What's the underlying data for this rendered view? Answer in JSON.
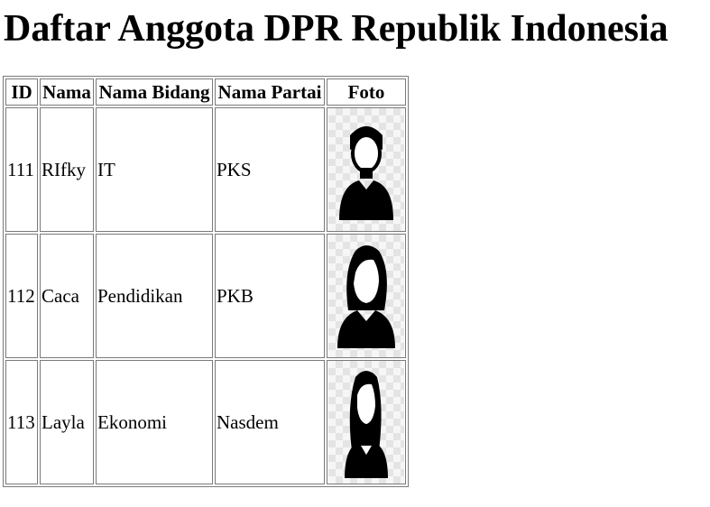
{
  "page": {
    "title": "Daftar Anggota DPR Republik Indonesia"
  },
  "table": {
    "headers": {
      "id": "ID",
      "nama": "Nama",
      "bidang": "Nama Bidang",
      "partai": "Nama Partai",
      "foto": "Foto"
    },
    "rows": [
      {
        "id": "111",
        "nama": "RIfky",
        "bidang": "IT",
        "partai": "PKS",
        "photo_icon": "male-avatar-icon"
      },
      {
        "id": "112",
        "nama": "Caca",
        "bidang": "Pendidikan",
        "partai": "PKB",
        "photo_icon": "female-avatar-icon"
      },
      {
        "id": "113",
        "nama": "Layla",
        "bidang": "Ekonomi",
        "partai": "Nasdem",
        "photo_icon": "female-long-hair-avatar-icon"
      }
    ]
  }
}
